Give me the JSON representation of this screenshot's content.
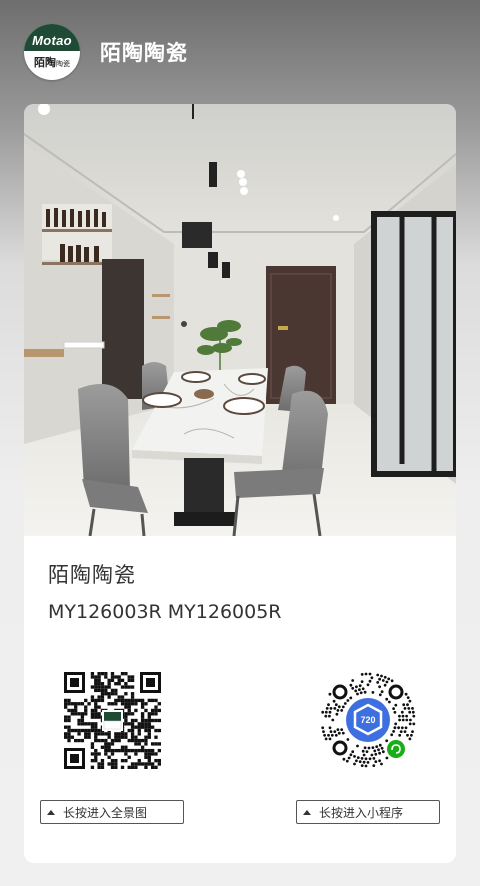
{
  "header": {
    "logo_brand": "Motao",
    "logo_cn_main": "陌陶",
    "logo_cn_sub": "陶瓷",
    "title": "陌陶陶瓷"
  },
  "card": {
    "brand_name": "陌陶陶瓷",
    "models": "MY126003R MY126005R",
    "panorama_button": "长按进入全景图",
    "miniprogram_button": "长按进入小程序",
    "miniprogram_badge": "720"
  },
  "colors": {
    "logo_green": "#1f4a36",
    "wechat_green": "#1aad19",
    "badge_blue": "#3d6fe0"
  }
}
